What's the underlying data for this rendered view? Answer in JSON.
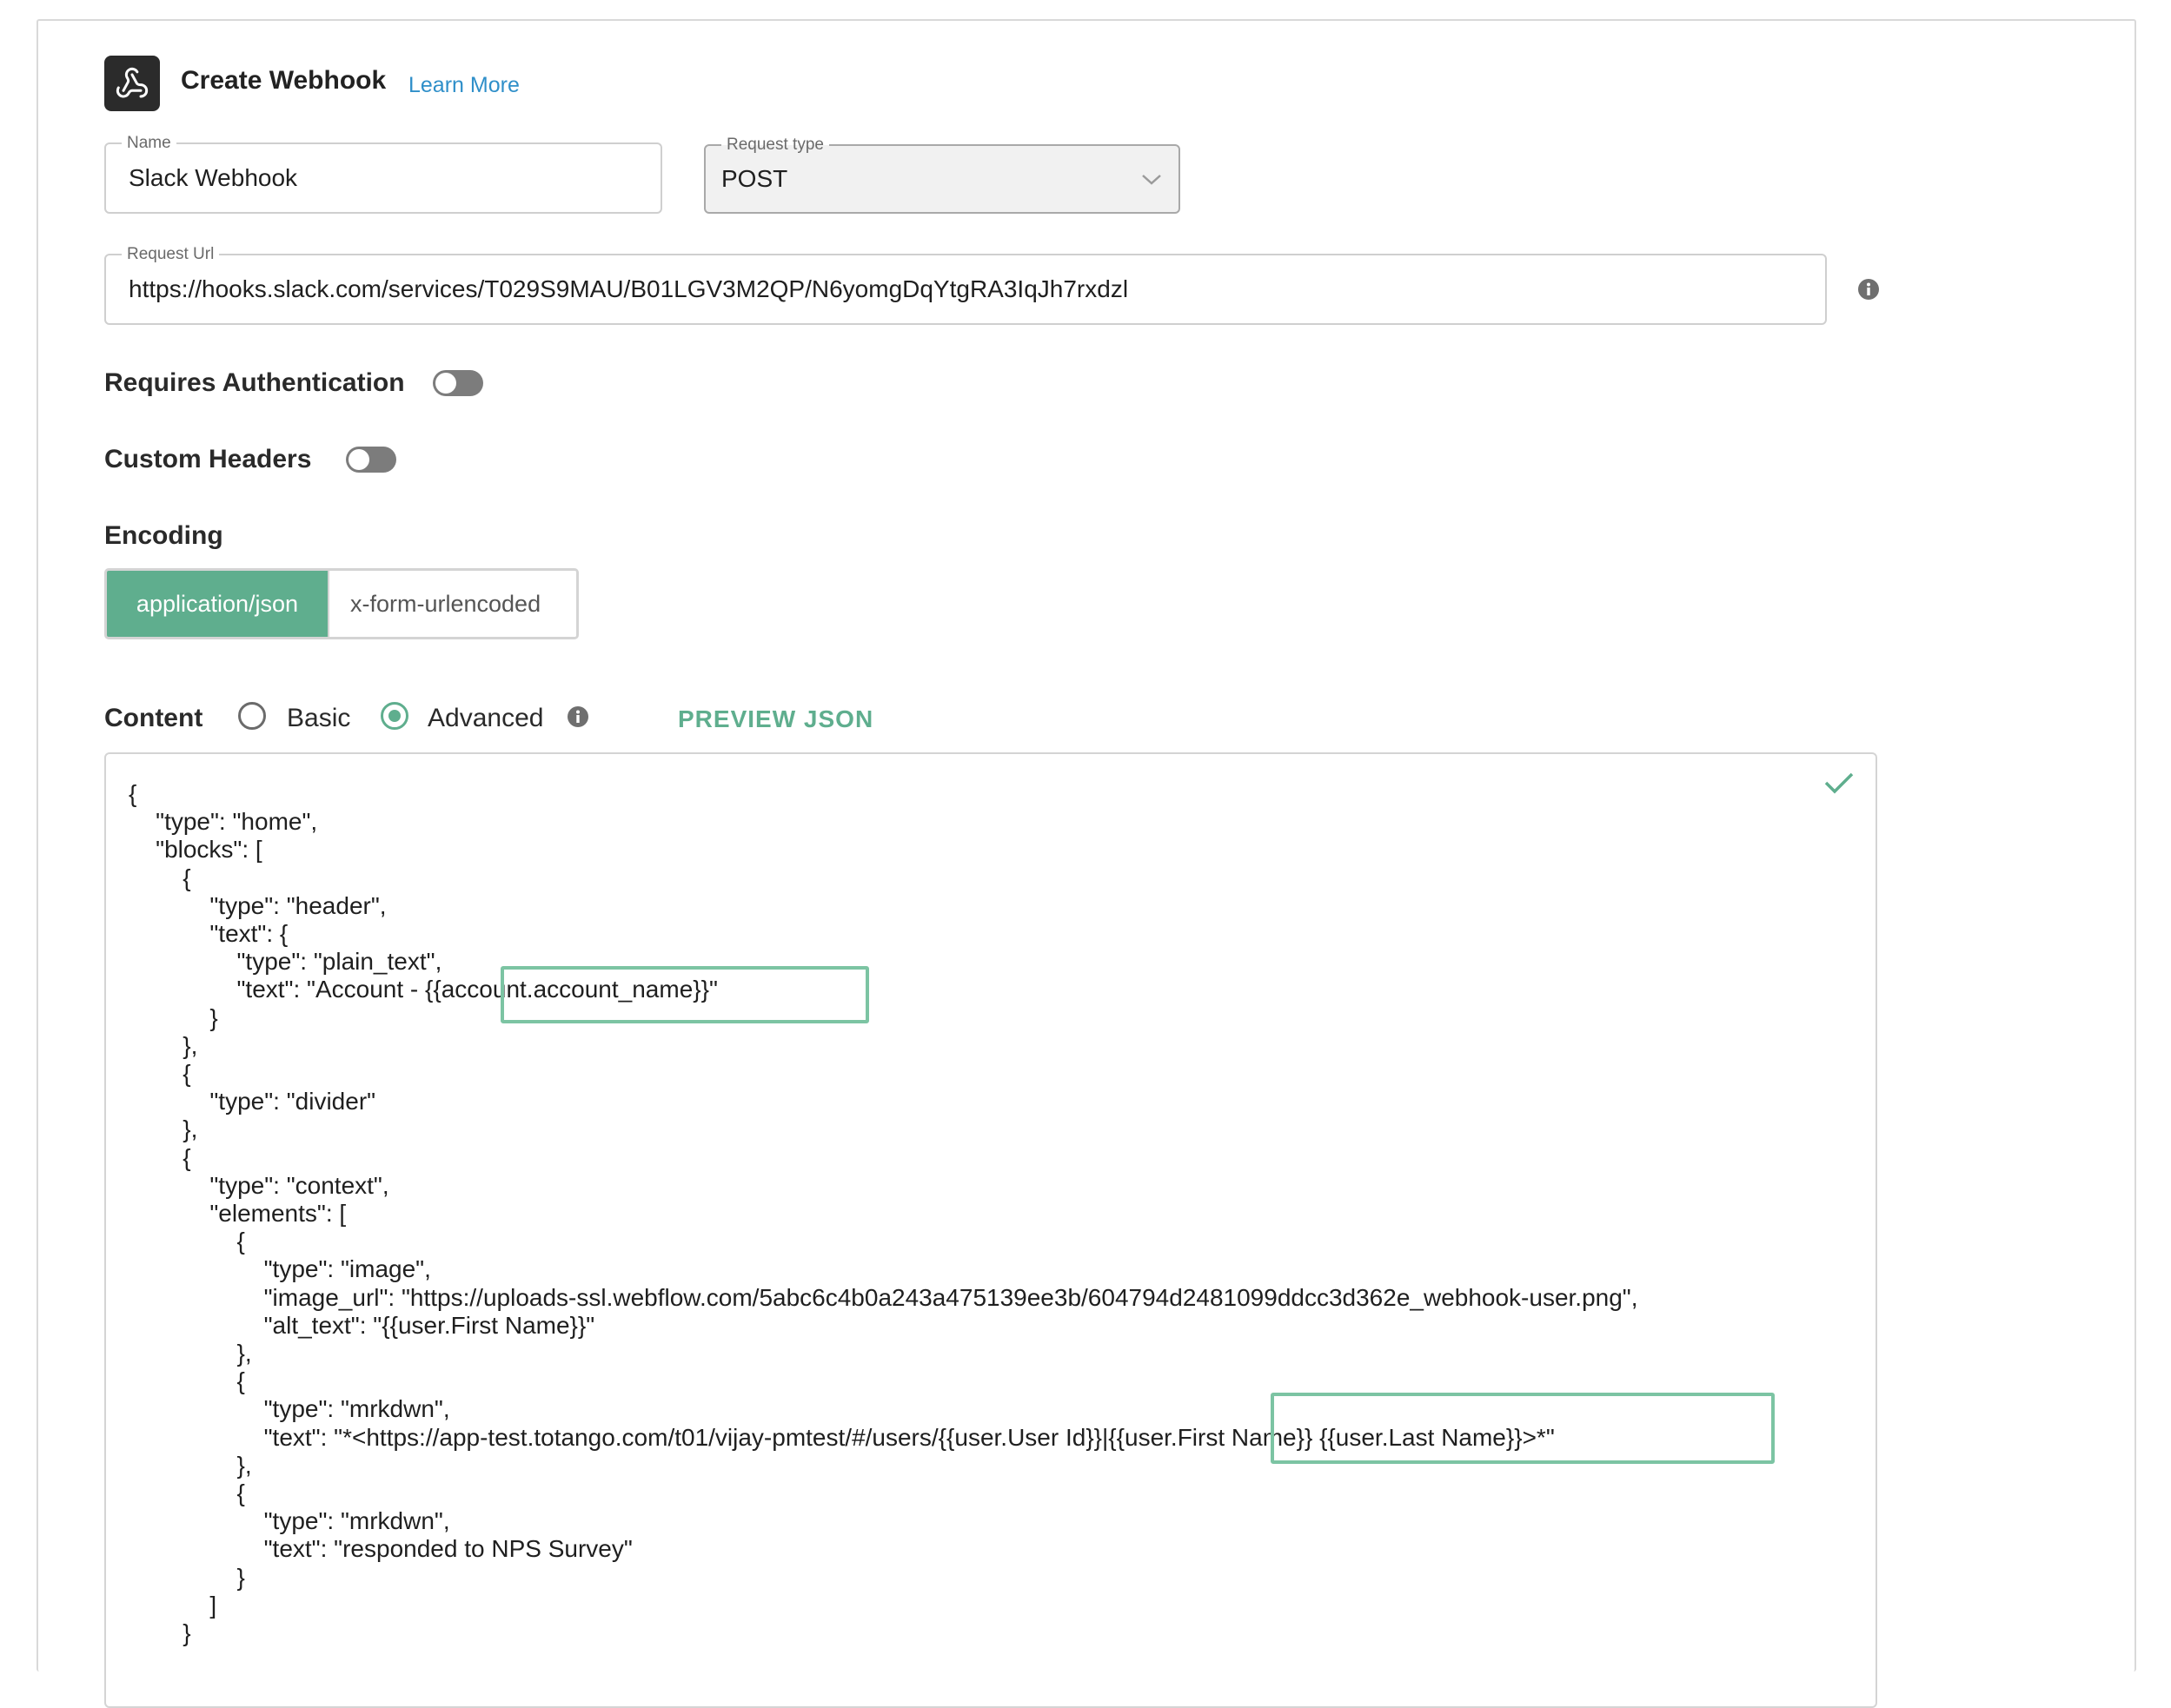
{
  "header": {
    "title": "Create Webhook",
    "learn_more": "Learn More",
    "icon": "webhook-icon"
  },
  "form": {
    "name": {
      "label": "Name",
      "value": "Slack Webhook"
    },
    "request_type": {
      "label": "Request type",
      "value": "POST"
    },
    "request_url": {
      "label": "Request Url",
      "value": "https://hooks.slack.com/services/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"
    }
  },
  "toggles": {
    "requires_auth": {
      "label": "Requires Authentication",
      "on": false
    },
    "custom_headers": {
      "label": "Custom Headers",
      "on": false
    }
  },
  "encoding": {
    "label": "Encoding",
    "options": [
      "application/json",
      "x-form-urlencoded"
    ],
    "selected": "application/json"
  },
  "content": {
    "label": "Content",
    "modes": [
      "Basic",
      "Advanced"
    ],
    "selected": "Advanced",
    "preview_button": "PREVIEW JSON"
  },
  "editor": {
    "valid_icon": "checkmark-icon",
    "accent_color": "#5fae8e",
    "code": "{\n\t\"type\": \"home\",\n\t\"blocks\": [\n\t\t{\n\t\t\t\"type\": \"header\",\n\t\t\t\"text\": {\n\t\t\t\t\"type\": \"plain_text\",\n\t\t\t\t\"text\": \"Account - {{account.account_name}}\"\n\t\t\t}\n\t\t},\n\t\t{\n\t\t\t\"type\": \"divider\"\n\t\t},\n\t\t{\n\t\t\t\"type\": \"context\",\n\t\t\t\"elements\": [\n\t\t\t\t{\n\t\t\t\t\t\"type\": \"image\",\n\t\t\t\t\t\"image_url\": \"https://uploads-ssl.webflow.com/5abc6c4b0a243a475139ee3b/604794d2481099ddcc3d362e_webhook-user.png\",\n\t\t\t\t\t\"alt_text\": \"{{user.First Name}}\"\n\t\t\t\t},\n\t\t\t\t{\n\t\t\t\t\t\"type\": \"mrkdwn\",\n\t\t\t\t\t\"text\": \"*<https://app-test.totango.com/t01/vijay-pmtest/#/users/{{user.User Id}}|{{user.First Name}} {{user.Last Name}}>*\"\n\t\t\t\t},\n\t\t\t\t{\n\t\t\t\t\t\"type\": \"mrkdwn\",\n\t\t\t\t\t\"text\": \"responded to NPS Survey\"\n\t\t\t\t}\n\t\t\t]\n\t\t}"
  }
}
